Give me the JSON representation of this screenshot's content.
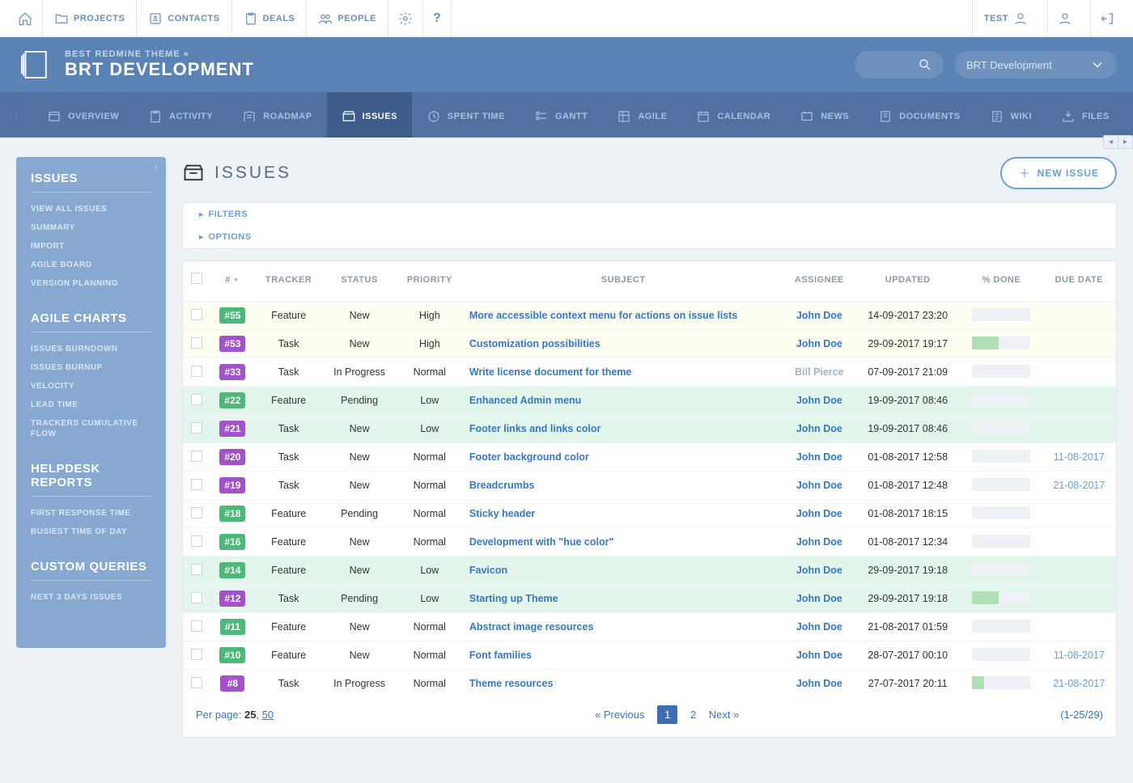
{
  "topnav": {
    "left": [
      "PROJECTS",
      "CONTACTS",
      "DEALS",
      "PEOPLE"
    ],
    "test_label": "TEST"
  },
  "header": {
    "breadcrumb": "BEST REDMINE THEME »",
    "title": "BRT DEVELOPMENT",
    "project_selector": "BRT Development"
  },
  "projtabs": [
    {
      "label": "OVERVIEW"
    },
    {
      "label": "ACTIVITY"
    },
    {
      "label": "ROADMAP"
    },
    {
      "label": "ISSUES",
      "active": true
    },
    {
      "label": "SPENT TIME"
    },
    {
      "label": "GANTT"
    },
    {
      "label": "AGILE"
    },
    {
      "label": "CALENDAR"
    },
    {
      "label": "NEWS"
    },
    {
      "label": "DOCUMENTS"
    },
    {
      "label": "WIKI"
    },
    {
      "label": "FILES"
    }
  ],
  "sidebar": {
    "issues_heading": "ISSUES",
    "issues_links": [
      "VIEW ALL ISSUES",
      "SUMMARY",
      "IMPORT",
      "AGILE BOARD",
      "VERSION PLANNING"
    ],
    "agile_heading": "AGILE CHARTS",
    "agile_links": [
      "ISSUES BURNDOWN",
      "ISSUES BURNUP",
      "VELOCITY",
      "LEAD TIME",
      "TRACKERS CUMULATIVE FLOW"
    ],
    "helpdesk_heading": "HELPDESK REPORTS",
    "helpdesk_links": [
      "FIRST RESPONSE TIME",
      "BUSIEST TIME OF DAY"
    ],
    "custom_heading": "CUSTOM QUERIES",
    "custom_links": [
      "NEXT 3 DAYS ISSUES"
    ]
  },
  "page": {
    "title": "ISSUES",
    "new_btn": "NEW ISSUE",
    "filters": "FILTERS",
    "options": "OPTIONS"
  },
  "columns": [
    "#",
    "TRACKER",
    "STATUS",
    "PRIORITY",
    "SUBJECT",
    "ASSIGNEE",
    "UPDATED",
    "% DONE",
    "DUE DATE"
  ],
  "rows": [
    {
      "id": "#55",
      "idc": "green",
      "tracker": "Feature",
      "status": "New",
      "priority": "High",
      "subject": "More accessible context menu for actions on issue lists",
      "assignee": "John Doe",
      "updated": "14-09-2017 23:20",
      "done": 0,
      "due": "",
      "bg": "yellow"
    },
    {
      "id": "#53",
      "idc": "purple",
      "tracker": "Task",
      "status": "New",
      "priority": "High",
      "subject": "Customization possibilities",
      "assignee": "John Doe",
      "updated": "29-09-2017 19:17",
      "done": 45,
      "due": "",
      "bg": "yellow"
    },
    {
      "id": "#33",
      "idc": "purple",
      "tracker": "Task",
      "status": "In Progress",
      "priority": "Normal",
      "subject": "Write license document for theme",
      "assignee": "Bill Pierce",
      "assignee_alt": true,
      "updated": "07-09-2017 21:09",
      "done": 0,
      "due": "",
      "bg": ""
    },
    {
      "id": "#22",
      "idc": "green",
      "tracker": "Feature",
      "status": "Pending",
      "priority": "Low",
      "subject": "Enhanced Admin menu",
      "assignee": "John Doe",
      "updated": "19-09-2017 08:46",
      "done": 0,
      "due": "",
      "bg": "green"
    },
    {
      "id": "#21",
      "idc": "purple",
      "tracker": "Task",
      "status": "New",
      "priority": "Low",
      "subject": "Footer links and links color",
      "assignee": "John Doe",
      "updated": "19-09-2017 08:46",
      "done": 0,
      "due": "",
      "bg": "green"
    },
    {
      "id": "#20",
      "idc": "purple",
      "tracker": "Task",
      "status": "New",
      "priority": "Normal",
      "subject": "Footer background color",
      "assignee": "John Doe",
      "updated": "01-08-2017 12:58",
      "done": 0,
      "due": "11-08-2017",
      "bg": ""
    },
    {
      "id": "#19",
      "idc": "purple",
      "tracker": "Task",
      "status": "New",
      "priority": "Normal",
      "subject": "Breadcrumbs",
      "assignee": "John Doe",
      "updated": "01-08-2017 12:48",
      "done": 0,
      "due": "21-08-2017",
      "bg": ""
    },
    {
      "id": "#18",
      "idc": "green",
      "tracker": "Feature",
      "status": "Pending",
      "priority": "Normal",
      "subject": "Sticky header",
      "assignee": "John Doe",
      "updated": "01-08-2017 18:15",
      "done": 0,
      "due": "",
      "bg": ""
    },
    {
      "id": "#16",
      "idc": "green",
      "tracker": "Feature",
      "status": "New",
      "priority": "Normal",
      "subject": "Development with \"hue color\"",
      "assignee": "John Doe",
      "updated": "01-08-2017 12:34",
      "done": 0,
      "due": "",
      "bg": ""
    },
    {
      "id": "#14",
      "idc": "green",
      "tracker": "Feature",
      "status": "New",
      "priority": "Low",
      "subject": "Favicon",
      "assignee": "John Doe",
      "updated": "29-09-2017 19:18",
      "done": 0,
      "due": "",
      "bg": "green"
    },
    {
      "id": "#12",
      "idc": "purple",
      "tracker": "Task",
      "status": "Pending",
      "priority": "Low",
      "subject": "Starting up Theme",
      "assignee": "John Doe",
      "updated": "29-09-2017 19:18",
      "done": 45,
      "due": "",
      "bg": "green"
    },
    {
      "id": "#11",
      "idc": "green",
      "tracker": "Feature",
      "status": "New",
      "priority": "Normal",
      "subject": "Abstract image resources",
      "assignee": "John Doe",
      "updated": "21-08-2017 01:59",
      "done": 0,
      "due": "",
      "bg": ""
    },
    {
      "id": "#10",
      "idc": "green",
      "tracker": "Feature",
      "status": "New",
      "priority": "Normal",
      "subject": "Font families",
      "assignee": "John Doe",
      "updated": "28-07-2017 00:10",
      "done": 0,
      "due": "11-08-2017",
      "bg": ""
    },
    {
      "id": "#8",
      "idc": "purple",
      "tracker": "Task",
      "status": "In Progress",
      "priority": "Normal",
      "subject": "Theme resources",
      "assignee": "John Doe",
      "updated": "27-07-2017 20:11",
      "done": 20,
      "due": "21-08-2017",
      "bg": ""
    }
  ],
  "footer": {
    "perpage_label": "Per page:",
    "perpage_active": "25",
    "perpage_other": "50",
    "prev": "« Previous",
    "page1": "1",
    "page2": "2",
    "next": "Next »",
    "range": "(1-25/29)"
  }
}
